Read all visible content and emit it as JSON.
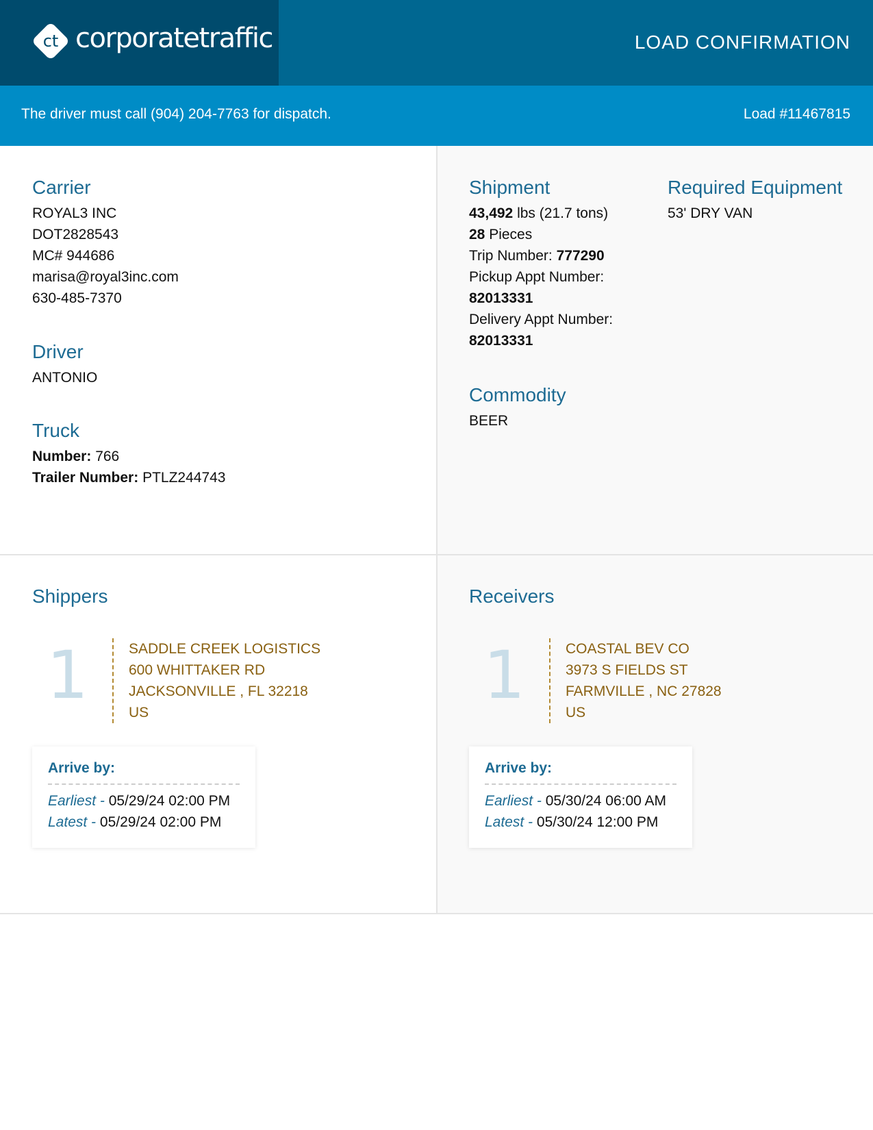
{
  "header": {
    "logo_text": "corporatetraffic",
    "logo_mark": "ct",
    "title": "LOAD CONFIRMATION",
    "colors": {
      "header": "#006791",
      "logo_block": "#004b6d",
      "dispatch_bar": "#008cc6"
    }
  },
  "dispatch": {
    "message": "The driver must call (904) 204-7763 for dispatch.",
    "load_number": "Load #11467815"
  },
  "carrier": {
    "heading": "Carrier",
    "name": "ROYAL3 INC",
    "dot": "DOT2828543",
    "mc": "MC# 944686",
    "email": "marisa@royal3inc.com",
    "phone": "630-485-7370"
  },
  "driver": {
    "heading": "Driver",
    "name": "ANTONIO"
  },
  "truck": {
    "heading": "Truck",
    "number_label": "Number:",
    "number": "766",
    "trailer_label": "Trailer Number:",
    "trailer": "PTLZ244743"
  },
  "shipment": {
    "heading": "Shipment",
    "weight": "43,492",
    "weight_suffix": "lbs (21.7 tons)",
    "pieces": "28",
    "pieces_suffix": "Pieces",
    "trip_label": "Trip Number:",
    "trip": "777290",
    "pickup_label": "Pickup Appt Number:",
    "pickup": "82013331",
    "delivery_label": "Delivery Appt Number:",
    "delivery": "82013331"
  },
  "equipment": {
    "heading": "Required Equipment",
    "value": "53' DRY VAN"
  },
  "commodity": {
    "heading": "Commodity",
    "value": "BEER"
  },
  "shippers": {
    "heading": "Shippers",
    "stop_number": "1",
    "name": "SADDLE CREEK LOGISTICS",
    "street": "600 WHITTAKER RD",
    "city": "JACKSONVILLE , FL 32218",
    "country": "US",
    "arrive_label": "Arrive by:",
    "earliest_label": "Earliest -",
    "earliest": "05/29/24 02:00 PM",
    "latest_label": "Latest -",
    "latest": "05/29/24 02:00 PM"
  },
  "receivers": {
    "heading": "Receivers",
    "stop_number": "1",
    "name": "COASTAL BEV CO",
    "street": "3973 S FIELDS ST",
    "city": "FARMVILLE , NC 27828",
    "country": "US",
    "arrive_label": "Arrive by:",
    "earliest_label": "Earliest -",
    "earliest": "05/30/24 06:00 AM",
    "latest_label": "Latest -",
    "latest": "05/30/24 12:00 PM"
  }
}
